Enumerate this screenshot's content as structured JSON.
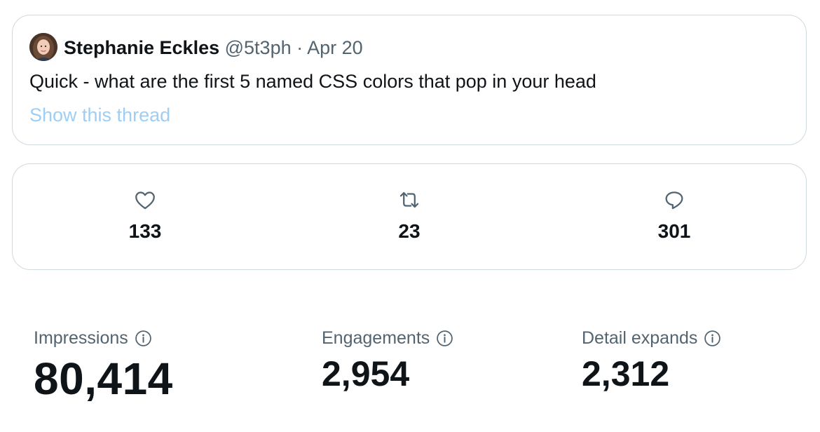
{
  "tweet": {
    "author_name": "Stephanie Eckles",
    "handle": "@5t3ph",
    "separator": "·",
    "date": "Apr 20",
    "text": "Quick - what are the first 5 named CSS colors that pop in your head",
    "show_thread_label": "Show this thread"
  },
  "engagement": {
    "likes": {
      "icon": "heart-icon",
      "count": "133"
    },
    "retweets": {
      "icon": "retweet-icon",
      "count": "23"
    },
    "replies": {
      "icon": "reply-icon",
      "count": "301"
    }
  },
  "stats": [
    {
      "label": "Impressions",
      "value": "80,414",
      "icon": "info-icon"
    },
    {
      "label": "Engagements",
      "value": "2,954",
      "icon": "info-icon"
    },
    {
      "label": "Detail expands",
      "value": "2,312",
      "icon": "info-icon"
    }
  ],
  "colors": {
    "text": "#0f1419",
    "secondary": "#536471",
    "link_faded": "#9ecef5",
    "border": "#cfd9de"
  }
}
